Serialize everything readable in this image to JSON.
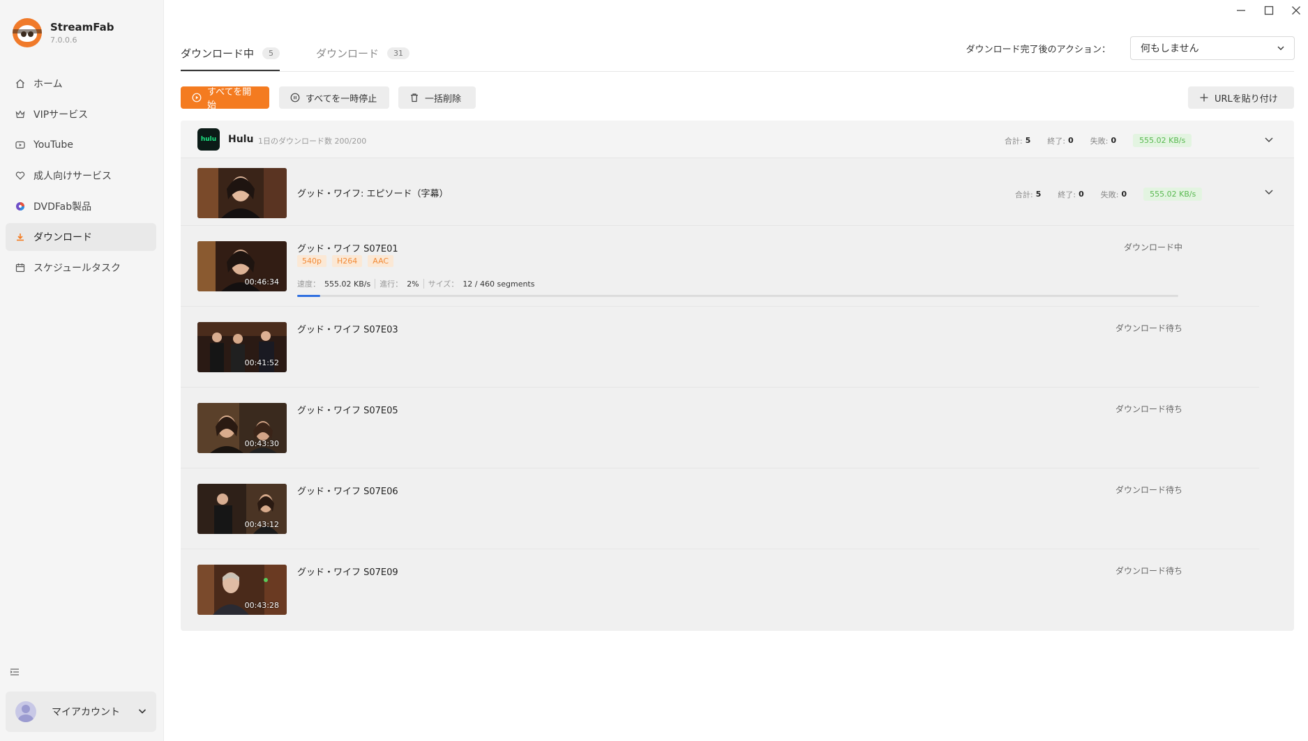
{
  "app": {
    "name": "StreamFab",
    "version": "7.0.0.6"
  },
  "sidebar": {
    "items": [
      {
        "label": "ホーム",
        "icon": "home-icon"
      },
      {
        "label": "VIPサービス",
        "icon": "crown-icon"
      },
      {
        "label": "YouTube",
        "icon": "youtube-icon"
      },
      {
        "label": "成人向けサービス",
        "icon": "heart-icon"
      },
      {
        "label": "DVDFab製品",
        "icon": "dvdfab-icon"
      },
      {
        "label": "ダウンロード",
        "icon": "download-icon"
      },
      {
        "label": "スケジュールタスク",
        "icon": "calendar-icon"
      }
    ],
    "active_index": 5,
    "account_label": "マイアカウント"
  },
  "tabs": [
    {
      "label": "ダウンロード中",
      "count": "5"
    },
    {
      "label": "ダウンロード",
      "count": "31"
    }
  ],
  "after_action": {
    "label": "ダウンロード完了後のアクション：",
    "value": "何もしません"
  },
  "toolbar": {
    "start_all": "すべてを開始",
    "pause_all": "すべてを一時停止",
    "delete_all": "一括削除",
    "paste_url": "URLを貼り付け"
  },
  "service": {
    "name": "Hulu",
    "logo_text": "hulu",
    "quota": "1日のダウンロード数 200/200",
    "stats": {
      "total_label": "合計:",
      "total": "5",
      "done_label": "終了:",
      "done": "0",
      "fail_label": "失敗:",
      "fail": "0",
      "speed": "555.02 KB/s"
    }
  },
  "series": {
    "title": "グッド・ワイフ: エピソード（字幕）",
    "stats": {
      "total_label": "合計:",
      "total": "5",
      "done_label": "終了:",
      "done": "0",
      "fail_label": "失敗:",
      "fail": "0",
      "speed": "555.02 KB/s"
    }
  },
  "episodes": [
    {
      "title": "グッド・ワイフ S07E01",
      "duration": "00:46:34",
      "status": "ダウンロード中",
      "tags": [
        "540p",
        "H264",
        "AAC"
      ],
      "progress": {
        "speed_label": "速度：",
        "speed": "555.02 KB/s",
        "progress_label": "進行：",
        "progress": "2%",
        "size_label": "サイズ：",
        "size": "12 / 460 segments",
        "fraction": 0.026
      }
    },
    {
      "title": "グッド・ワイフ S07E03",
      "duration": "00:41:52",
      "status": "ダウンロード待ち"
    },
    {
      "title": "グッド・ワイフ S07E05",
      "duration": "00:43:30",
      "status": "ダウンロード待ち"
    },
    {
      "title": "グッド・ワイフ S07E06",
      "duration": "00:43:12",
      "status": "ダウンロード待ち"
    },
    {
      "title": "グッド・ワイフ S07E09",
      "duration": "00:43:28",
      "status": "ダウンロード待ち"
    }
  ],
  "colors": {
    "accent": "#f47b20",
    "progress": "#2f6fe0",
    "speed_text": "#57b84f",
    "tag_text": "#f28a36"
  }
}
